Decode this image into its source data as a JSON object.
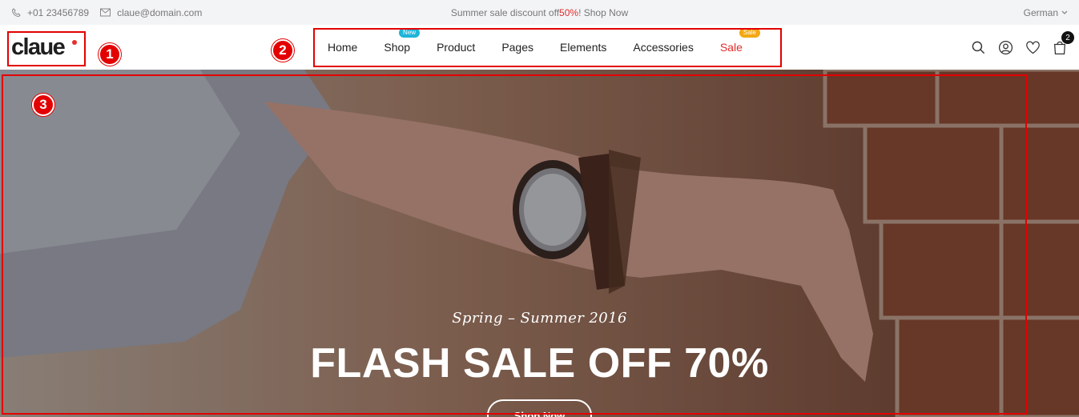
{
  "topbar": {
    "phone": "+01 23456789",
    "email": "claue@domain.com",
    "promo_before": "Summer sale discount off ",
    "promo_highlight": "50%",
    "promo_after": "! Shop Now",
    "language": "German"
  },
  "header": {
    "logo": "claue",
    "nav": [
      {
        "label": "Home"
      },
      {
        "label": "Shop",
        "badge": "New"
      },
      {
        "label": "Product"
      },
      {
        "label": "Pages"
      },
      {
        "label": "Elements"
      },
      {
        "label": "Accessories"
      },
      {
        "label": "Sale",
        "badge": "Sale"
      }
    ],
    "cart_count": "2",
    "icons": [
      "search-icon",
      "user-icon",
      "heart-icon",
      "cart-icon"
    ]
  },
  "hero": {
    "subtitle": "Spring – Summer 2016",
    "title": "FLASH SALE OFF 70%",
    "button": "Shop Now"
  },
  "annotations": [
    {
      "label": "1"
    },
    {
      "label": "2"
    },
    {
      "label": "3"
    }
  ],
  "colors": {
    "accent": "#e02b2b",
    "annotation": "#e30000",
    "badge_new": "#1fb4d9",
    "badge_sale": "#f3a712"
  }
}
